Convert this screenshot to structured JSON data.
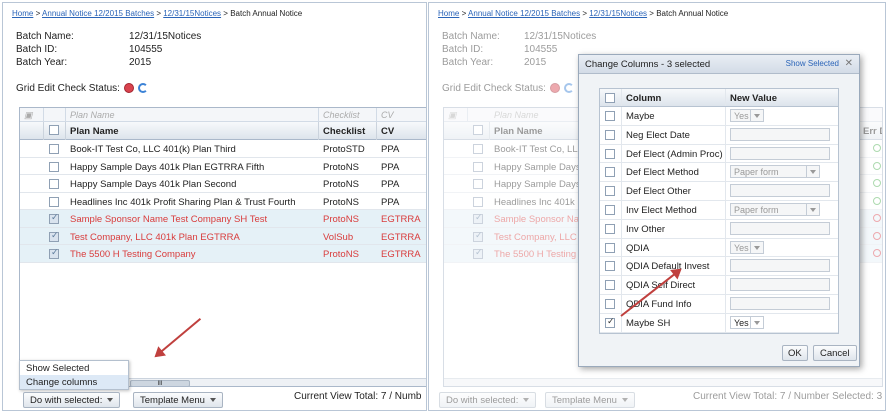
{
  "breadcrumb": [
    "Home",
    "Annual Notice 12/2015 Batches",
    "12/31/15Notices",
    "Batch Annual Notice"
  ],
  "batch": {
    "name_label": "Batch Name:",
    "name": "12/31/15Notices",
    "id_label": "Batch ID:",
    "id": "104555",
    "year_label": "Batch Year:",
    "year": "2015"
  },
  "grid_status_label": "Grid Edit Check Status:",
  "grid": {
    "filter": {
      "plan_name": "Plan Name",
      "checklist": "Checklist",
      "cv": "CV"
    },
    "headers": {
      "plan_name": "Plan Name",
      "checklist": "Checklist",
      "cv": "CV",
      "err": "Err D"
    },
    "rows": [
      {
        "plan": "Book-IT Test Co, LLC 401(k) Plan Third",
        "checklist": "ProtoSTD",
        "cv": "PPA",
        "checked": false,
        "red": false
      },
      {
        "plan": "Happy Sample Days 401k Plan EGTRRA Fifth",
        "checklist": "ProtoNS",
        "cv": "PPA",
        "checked": false,
        "red": false
      },
      {
        "plan": "Happy Sample Days 401k Plan Second",
        "checklist": "ProtoNS",
        "cv": "PPA",
        "checked": false,
        "red": false
      },
      {
        "plan": "Headlines Inc 401k Profit Sharing Plan & Trust Fourth",
        "checklist": "ProtoNS",
        "cv": "PPA",
        "checked": false,
        "red": false
      },
      {
        "plan": "Sample Sponsor Name Test Company SH Test",
        "checklist": "ProtoNS",
        "cv": "EGTRRA",
        "checked": true,
        "red": true
      },
      {
        "plan": "Test Company, LLC 401k Plan EGTRRA",
        "checklist": "VolSub",
        "cv": "EGTRRA",
        "checked": true,
        "red": true
      },
      {
        "plan": "The 5500 H Testing Company",
        "checklist": "ProtoNS",
        "cv": "EGTRRA",
        "checked": true,
        "red": true
      }
    ],
    "right_rows": [
      "Book-IT Test Co, LLC 4",
      "Happy Sample Days 4",
      "Happy Sample Days 4",
      "Headlines Inc 401k P",
      "Sample Sponsor Nam",
      "Test Company, LLC 4",
      "The 5500 H Testing C"
    ],
    "scroll_marker": "III"
  },
  "menu": {
    "show_selected": "Show Selected",
    "change_columns": "Change columns"
  },
  "toolbar": {
    "do_with_selected": "Do with selected:",
    "template_menu": "Template Menu"
  },
  "total_left": "Current View Total: 7 / Numb",
  "total_right": "Current View Total: 7 / Number Selected: 3",
  "dialog": {
    "title": "Change Columns - 3 selected",
    "show_selected": "Show Selected",
    "col_header": "Column",
    "val_header": "New Value",
    "rows": [
      {
        "name": "Maybe",
        "type": "select",
        "value": "Yes",
        "checked": false
      },
      {
        "name": "Neg Elect Date",
        "type": "input",
        "value": "",
        "checked": false
      },
      {
        "name": "Def Elect (Admin Proc)",
        "type": "input",
        "value": "",
        "checked": false
      },
      {
        "name": "Def Elect Method",
        "type": "select",
        "value": "Paper form",
        "checked": false
      },
      {
        "name": "Def Elect Other",
        "type": "input",
        "value": "",
        "checked": false
      },
      {
        "name": "Inv Elect Method",
        "type": "select",
        "value": "Paper form",
        "checked": false
      },
      {
        "name": "Inv Other",
        "type": "input",
        "value": "",
        "checked": false
      },
      {
        "name": "QDIA",
        "type": "select",
        "value": "Yes",
        "checked": false
      },
      {
        "name": "QDIA Default Invest",
        "type": "input",
        "value": "",
        "checked": false
      },
      {
        "name": "QDIA Self Direct",
        "type": "input",
        "value": "",
        "checked": false
      },
      {
        "name": "QDIA Fund Info",
        "type": "input",
        "value": "",
        "checked": false
      },
      {
        "name": "Maybe SH",
        "type": "select",
        "value": "Yes",
        "checked": true
      }
    ],
    "ok": "OK",
    "cancel": "Cancel"
  },
  "colors": {
    "accent": "#2a64b8",
    "error_text": "#d93c3c",
    "selected_row": "#e5f1f7",
    "arrow": "#c0403e"
  }
}
